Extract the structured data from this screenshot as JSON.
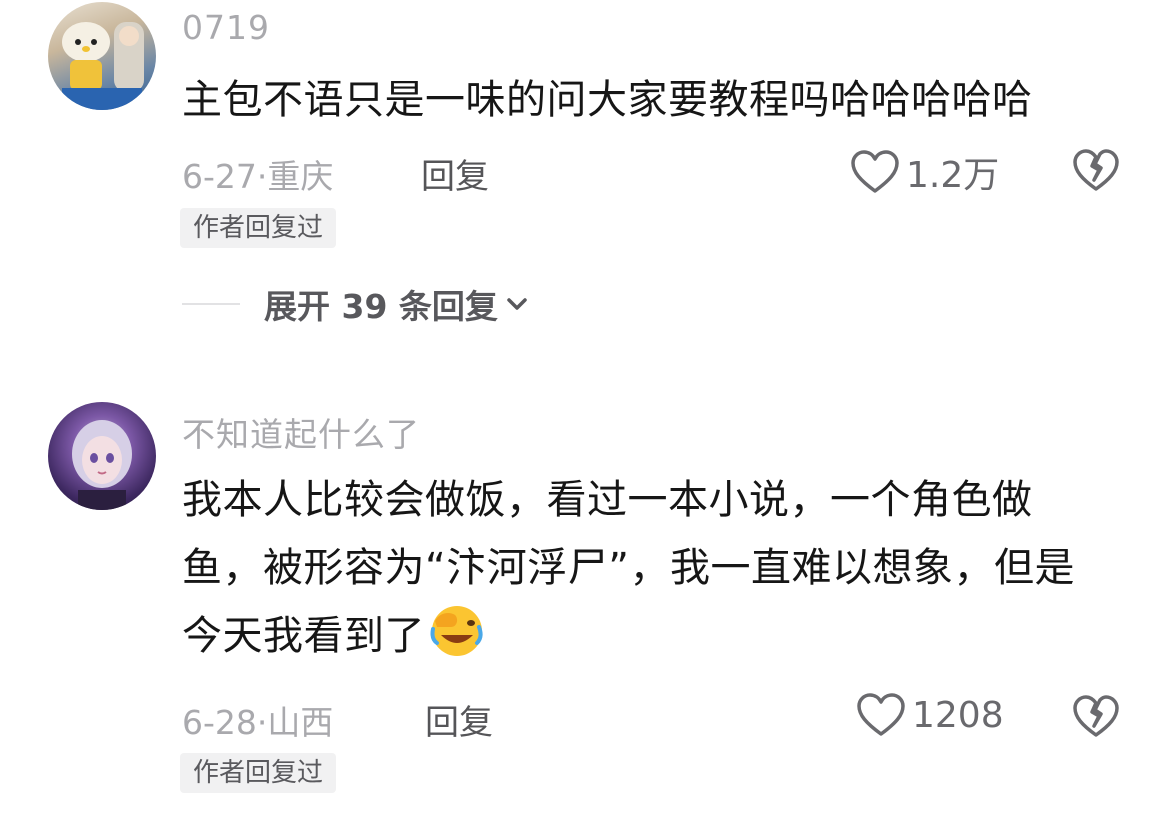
{
  "comments": [
    {
      "username": "0719",
      "text": "主包不语只是一味的问大家要教程吗哈哈哈哈哈",
      "date": "6-27",
      "location": "重庆",
      "reply_label": "回复",
      "like_count": "1.2万",
      "author_badge": "作者回复过",
      "expand_label": "展开 39 条回复"
    },
    {
      "username": "不知道起什么了",
      "text": "我本人比较会做饭，看过一本小说，一个角色做鱼，被形容为“汴河浮尸”，我一直难以想象，但是今天我看到了",
      "emoji": "facepalm-laughing-emoji",
      "date": "6-28",
      "location": "山西",
      "reply_label": "回复",
      "like_count": "1208",
      "author_badge": "作者回复过"
    }
  ],
  "meta_separator": "·",
  "colors": {
    "meta_gray": "#a9a9ad",
    "text": "#161616",
    "badge_bg": "#f1f1f2"
  }
}
